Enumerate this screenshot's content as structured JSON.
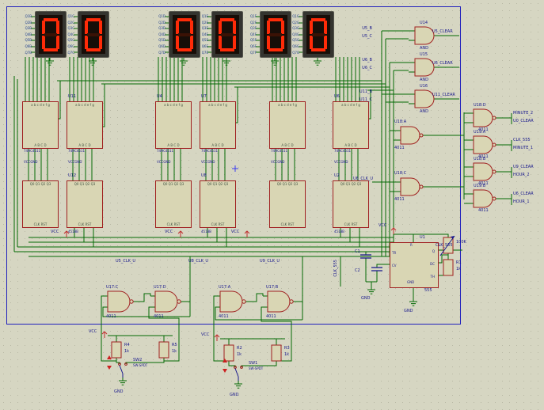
{
  "colors": {
    "background": "#d6d6c2",
    "grid_dot": "#b9b9a5",
    "sheet_border": "#2121bd",
    "wire": "#046a04",
    "component_outline": "#a02020",
    "component_fill": "#d9d6b4",
    "segment_on": "#ff2b08",
    "display_screen": "#170e08",
    "label_text": "#17178c"
  },
  "displays": [
    {
      "digit": "0",
      "pins": "Q1B\nQ2B\nQ3B\nQ4B\nQ5B\nQ6B\nQ7B"
    },
    {
      "digit": "0",
      "pins": "Q1C\nQ2C\nQ3C\nQ4C\nQ5C\nQ6C\nQ7C"
    },
    {
      "digit": "0",
      "pins": "Q1D\nQ2D\nQ3D\nQ4D\nQ5D\nQ6D\nQ7D"
    },
    {
      "digit": "0",
      "pins": "Q1E\nQ2E\nQ3E\nQ4E\nQ5E\nQ6E\nQ7E"
    },
    {
      "digit": "0",
      "pins": "Q1F\nQ2F\nQ3F\nQ4F\nQ5F\nQ6F\nQ7F"
    },
    {
      "digit": "0",
      "pins": "Q1G\nQ2G\nQ3G\nQ4G\nQ5G\nQ6G\nQ7G"
    }
  ],
  "decoders": [
    {
      "ref": "",
      "value": "74HC4511"
    },
    {
      "ref": "U11",
      "value": "74HC4511"
    },
    {
      "ref": "U4",
      "value": "74HC4511"
    },
    {
      "ref": "U7",
      "value": "74HC4511"
    },
    {
      "ref": "",
      "value": "74HC4511"
    },
    {
      "ref": "U6",
      "value": "74HC4511"
    }
  ],
  "counters": [
    {
      "ref": "U12",
      "value": "4518B"
    },
    {
      "ref": "U8",
      "value": "4518B"
    },
    {
      "ref": "U2",
      "value": "4518B"
    }
  ],
  "ic_pins": {
    "decoder_top": "a b c d e f g",
    "decoder_bottom": "A B C D",
    "counter_top": "Q0 Q1 Q2 Q3",
    "counter_bottom": "CLK RST",
    "vccgnd": "VCCGND"
  },
  "and_gates": [
    {
      "ref": "U14",
      "value": "AND",
      "in1": "U5_B",
      "in2": "U5_C",
      "out": "U5_CLEAR"
    },
    {
      "ref": "U15",
      "value": "AND",
      "in1": "U6_B",
      "in2": "U6_C",
      "out": "U6_CLEAR"
    },
    {
      "ref": "U16",
      "value": "AND",
      "in1": "U11_B",
      "in2": "U11_C",
      "out": "U11_CLEAR"
    }
  ],
  "nand_gates_mid": [
    {
      "ref": "U18:A",
      "value": "4011"
    },
    {
      "ref": "U18:C",
      "value": "4011"
    }
  ],
  "nand_gates_right": [
    {
      "ref": "U18:D",
      "value": "4011",
      "out1": "MINUTE_2",
      "out2": "U0_CLEAR"
    },
    {
      "ref": "U19:A",
      "value": "4011",
      "out1": "CLK_555",
      "out2": "MINUTE_1"
    },
    {
      "ref": "U18:B",
      "value": "4011",
      "out1": "U9_CLEAR",
      "out2": "HOUR_2"
    },
    {
      "ref": "U19:B",
      "value": "4011",
      "out1": "U6_CLEAR",
      "out2": "HOUR_1"
    }
  ],
  "bottom_gates": [
    {
      "ref": "U17:C",
      "value": "4011"
    },
    {
      "ref": "U17:D",
      "value": "4011"
    },
    {
      "ref": "U17:A",
      "value": "4011"
    },
    {
      "ref": "U17:B",
      "value": "4011"
    }
  ],
  "resistors": [
    {
      "ref": "R4",
      "value": "1k"
    },
    {
      "ref": "R5",
      "value": "1k"
    },
    {
      "ref": "R2",
      "value": "1k"
    },
    {
      "ref": "R3",
      "value": "1k"
    },
    {
      "ref": "R1",
      "value": "1k"
    }
  ],
  "potentiometer": {
    "value": "100K"
  },
  "timer": {
    "ref": "U1",
    "value": "555",
    "pin_top": "R",
    "pins_left": "TR\nCV",
    "pins_right": "Q\nDC\nTH",
    "pin_bottom": "GND"
  },
  "capacitors": [
    {
      "ref": "C1"
    },
    {
      "ref": "C2"
    }
  ],
  "switches": [
    {
      "ref": "SW2",
      "value": "SW-SPDT"
    },
    {
      "ref": "SW1",
      "value": "SW-SPDT"
    }
  ],
  "net_labels": {
    "u5_clk_u": "U5_CLK_U",
    "u8_clk_u": "U8_CLK_U",
    "u9_clk_u": "U9_CLK_U",
    "u6_clk_u": "U6_CLK_U",
    "clk_555": "CLK_555"
  },
  "power": {
    "vcc": "VCC",
    "gnd": "GND"
  }
}
